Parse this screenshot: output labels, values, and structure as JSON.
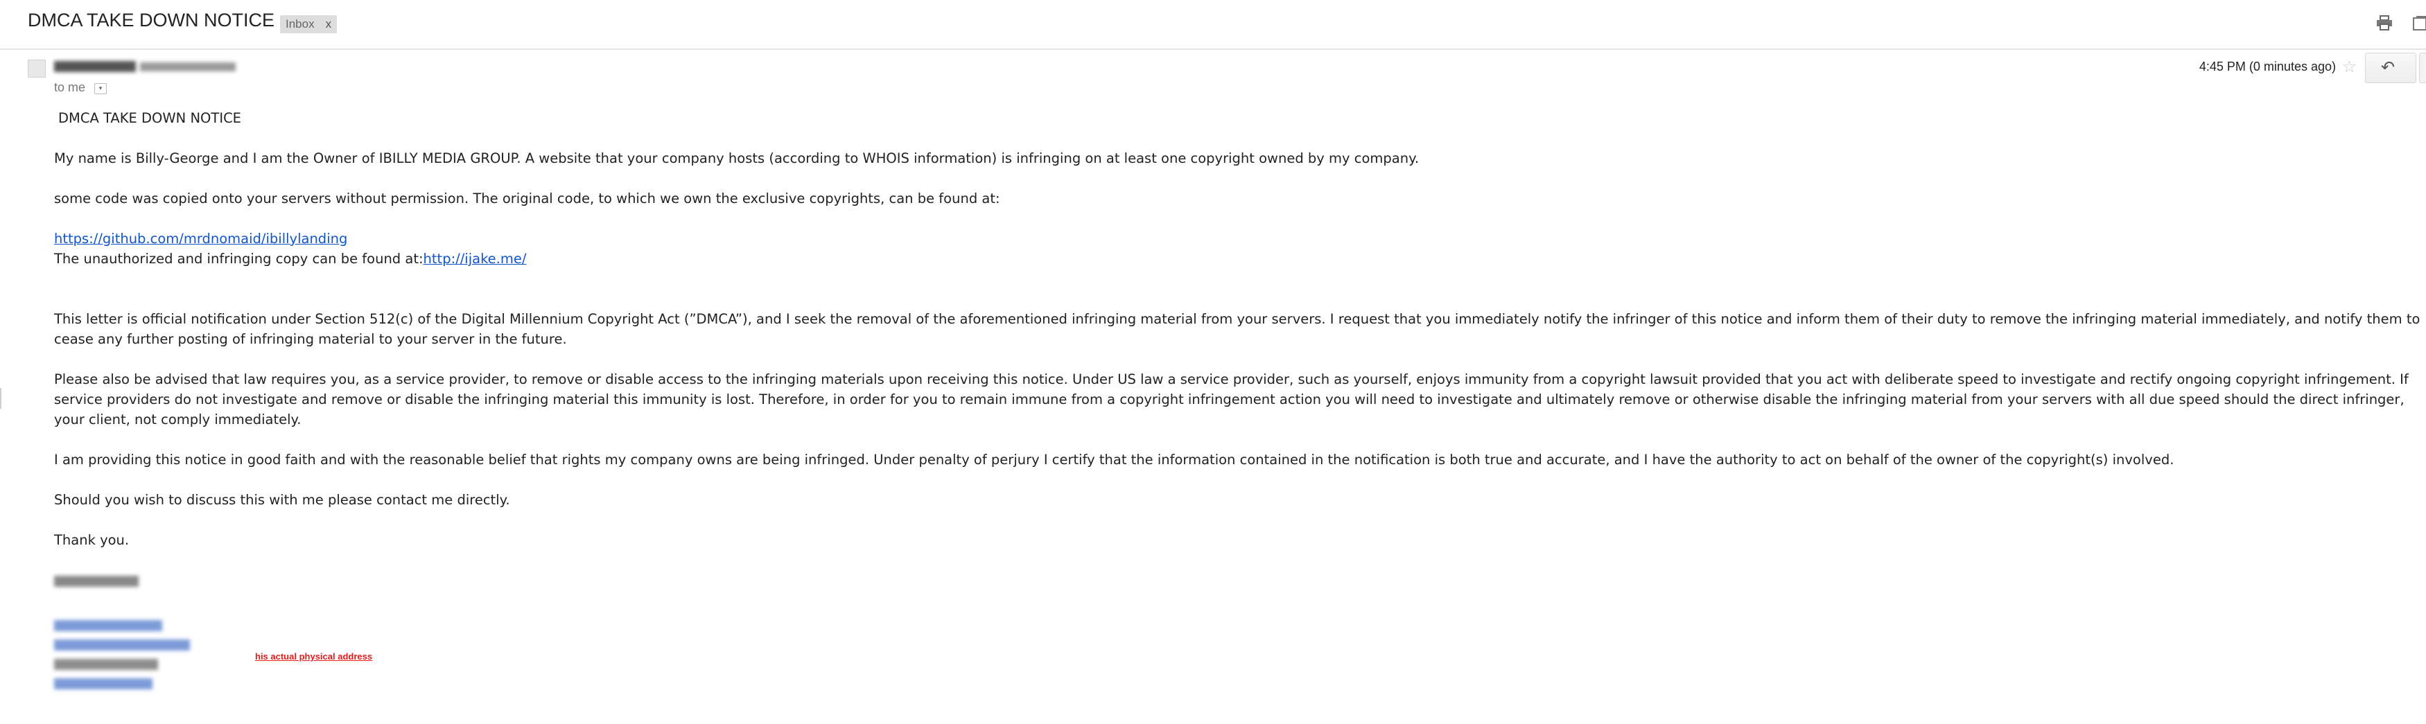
{
  "subject": "DMCA TAKE DOWN NOTICE",
  "label": {
    "text": "Inbox",
    "close": "x"
  },
  "header": {
    "to_me": "to me",
    "time": "4:45 PM (0 minutes ago)"
  },
  "icons": {
    "print": "print-icon",
    "new_window": "new-window-icon",
    "star": "star-icon",
    "reply": "reply-icon",
    "avatar": "avatar-icon"
  },
  "body": {
    "heading": "DMCA TAKE DOWN NOTICE",
    "p1": "My name is Billy-George and I am the Owner of IBILLY MEDIA GROUP.  A website that your company hosts (according to WHOIS information) is infringing on at least one copyright owned by my company.",
    "p2": "some code was copied onto your servers without permission. The original code, to which we own the exclusive copyrights, can be found at:",
    "link1": "https://github.com/mrdnomaid/ibillylanding",
    "p3_prefix": "The unauthorized and infringing copy can be found at:",
    "link2": "http://ijake.me/",
    "p4": "This letter is official notification under Section 512(c) of the Digital Millennium Copyright Act (”DMCA”), and I seek the removal of the aforementioned infringing material from your servers. I request that you immediately notify the infringer of this notice and inform them of their duty to remove the infringing material immediately, and notify them to cease any further posting of infringing material to your server in the future.",
    "p5": "Please also be advised that law requires you, as a service provider, to remove or disable access to the infringing materials upon receiving this notice. Under US law a service provider, such as yourself, enjoys immunity from a copyright lawsuit provided that you act with deliberate speed to investigate and rectify ongoing copyright infringement. If service providers do not investigate and remove or disable the infringing material this immunity is lost. Therefore, in order for you to remain immune from a copyright infringement action you will need to investigate and ultimately remove or otherwise disable the infringing material from your servers with all due speed should the direct infringer, your client, not comply immediately.",
    "p6": "I am providing this notice in good faith and with the reasonable belief that rights my company owns are being infringed. Under penalty of perjury I certify that the information contained in the notification is both true and accurate, and I have the authority to act on behalf of the owner of the copyright(s) involved.",
    "p7": "Should you wish to discuss this with me please contact me directly.",
    "p8": "Thank you."
  },
  "annotation": "his actual physical address",
  "colors": {
    "link": "#1155cc",
    "annotation": "#e21b1b",
    "label_bg": "#dddddd"
  }
}
